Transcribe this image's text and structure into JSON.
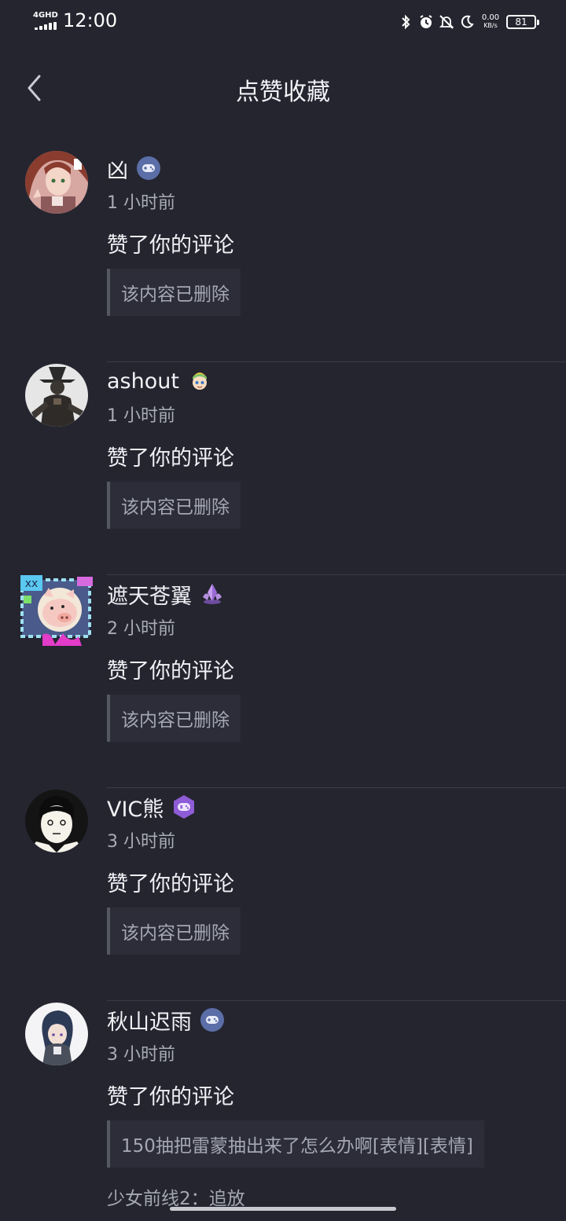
{
  "status_bar": {
    "network": "4GHD",
    "time": "12:00",
    "net_speed_value": "0.00",
    "net_speed_unit": "KB/s",
    "battery": "81"
  },
  "header": {
    "title": "点赞收藏"
  },
  "notifications": [
    {
      "user": "凶",
      "time": "1 小时前",
      "action": "赞了你的评论",
      "quote": "该内容已删除",
      "badge": "gamepad-badge-icon",
      "badge_color": "#5b6ea8"
    },
    {
      "user": "ashout",
      "time": "1 小时前",
      "action": "赞了你的评论",
      "quote": "该内容已删除",
      "badge": "character-badge-icon",
      "badge_color": "#7cc36a"
    },
    {
      "user": "遮天苍翼",
      "time": "2 小时前",
      "action": "赞了你的评论",
      "quote": "该内容已删除",
      "badge": "crystal-badge-icon",
      "badge_color": "#b48ee0"
    },
    {
      "user": "VIC熊",
      "time": "3 小时前",
      "action": "赞了你的评论",
      "quote": "该内容已删除",
      "badge": "gamepad-badge-icon",
      "badge_color": "#8e5cd6"
    },
    {
      "user": "秋山迟雨",
      "time": "3 小时前",
      "action": "赞了你的评论",
      "quote": "150抽把雷蒙抽出来了怎么办啊[表情][表情]",
      "badge": "gamepad-badge-icon",
      "badge_color": "#5b6ea8",
      "source": "少女前线2：追放"
    }
  ],
  "colors": {
    "background": "#24252f",
    "quote_background": "#2c2d38",
    "secondary_text": "#a9abb5"
  }
}
